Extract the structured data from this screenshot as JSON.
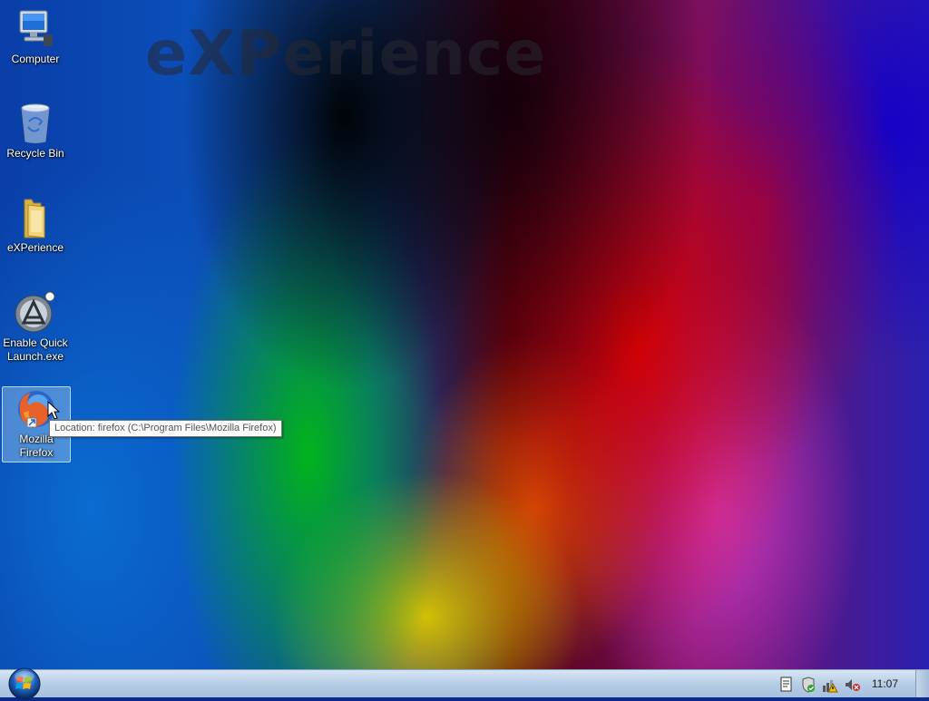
{
  "desktop": {
    "watermark": "eXPerience",
    "icons": [
      {
        "label": "Computer",
        "icon": "computer-icon"
      },
      {
        "label": "Recycle Bin",
        "icon": "recycle-bin-icon"
      },
      {
        "label": "eXPerience",
        "icon": "folder-icon"
      },
      {
        "label": "Enable Quick Launch.exe",
        "icon": "app-icon"
      },
      {
        "label": "Mozilla Firefox",
        "icon": "firefox-icon",
        "selected": true
      }
    ],
    "tooltip": "Location: firefox (C:\\Program Files\\Mozilla Firefox)"
  },
  "taskbar": {
    "start_icon": "windows-orb-icon",
    "tray_icons": [
      "document-icon",
      "shield-icon",
      "network-warning-icon",
      "volume-muted-icon"
    ],
    "clock": "11:07"
  }
}
